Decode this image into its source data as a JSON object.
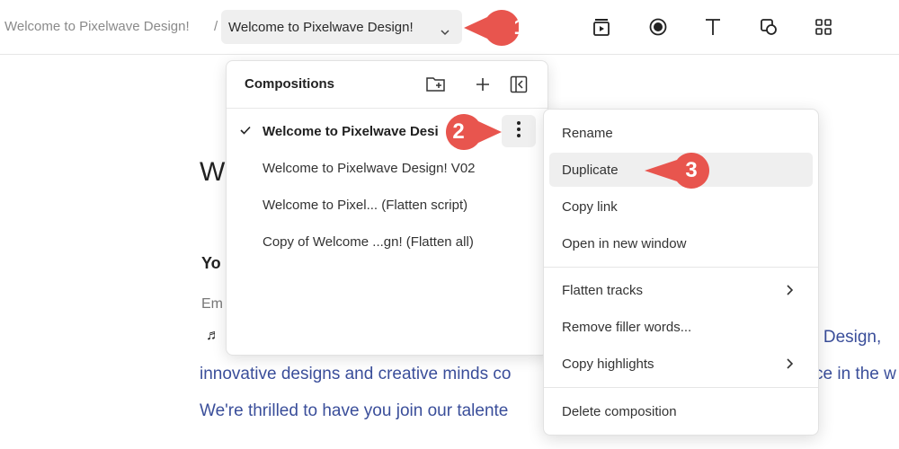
{
  "topbar": {
    "breadcrumb_prev": "Welcome to Pixelwave Design!",
    "breadcrumb_sep": "/",
    "breadcrumb_current": "Welcome to Pixelwave Design!",
    "tools": [
      "media-icon",
      "record-icon",
      "text-icon",
      "shapes-icon",
      "grid-icon"
    ]
  },
  "document": {
    "heading_partial": "W",
    "subheading_partial": "Yo",
    "label_partial": "Em",
    "note_glyph": "♬",
    "line_right1": "e Design,",
    "line_right2": "ce in the w",
    "line1": "innovative designs and creative minds co",
    "line2": "We're thrilled to have you join our talente"
  },
  "panel": {
    "title": "Compositions",
    "items": [
      {
        "label": "Welcome to Pixelwave Desi",
        "active": true
      },
      {
        "label": "Welcome to Pixelwave Design! V02",
        "active": false
      },
      {
        "label": "Welcome to Pixel... (Flatten script)",
        "active": false
      },
      {
        "label": "Copy of Welcome ...gn! (Flatten all)",
        "active": false
      }
    ]
  },
  "menu": {
    "items": [
      {
        "label": "Rename"
      },
      {
        "label": "Duplicate",
        "highlighted": true
      },
      {
        "label": "Copy link"
      },
      {
        "label": "Open in new window"
      },
      {
        "label": "Flatten tracks",
        "submenu": true
      },
      {
        "label": "Remove filler words..."
      },
      {
        "label": "Copy highlights",
        "submenu": true
      },
      {
        "label": "Delete composition"
      }
    ]
  },
  "callouts": {
    "one": "1",
    "two": "2",
    "three": "3",
    "color": "#e8554e"
  }
}
